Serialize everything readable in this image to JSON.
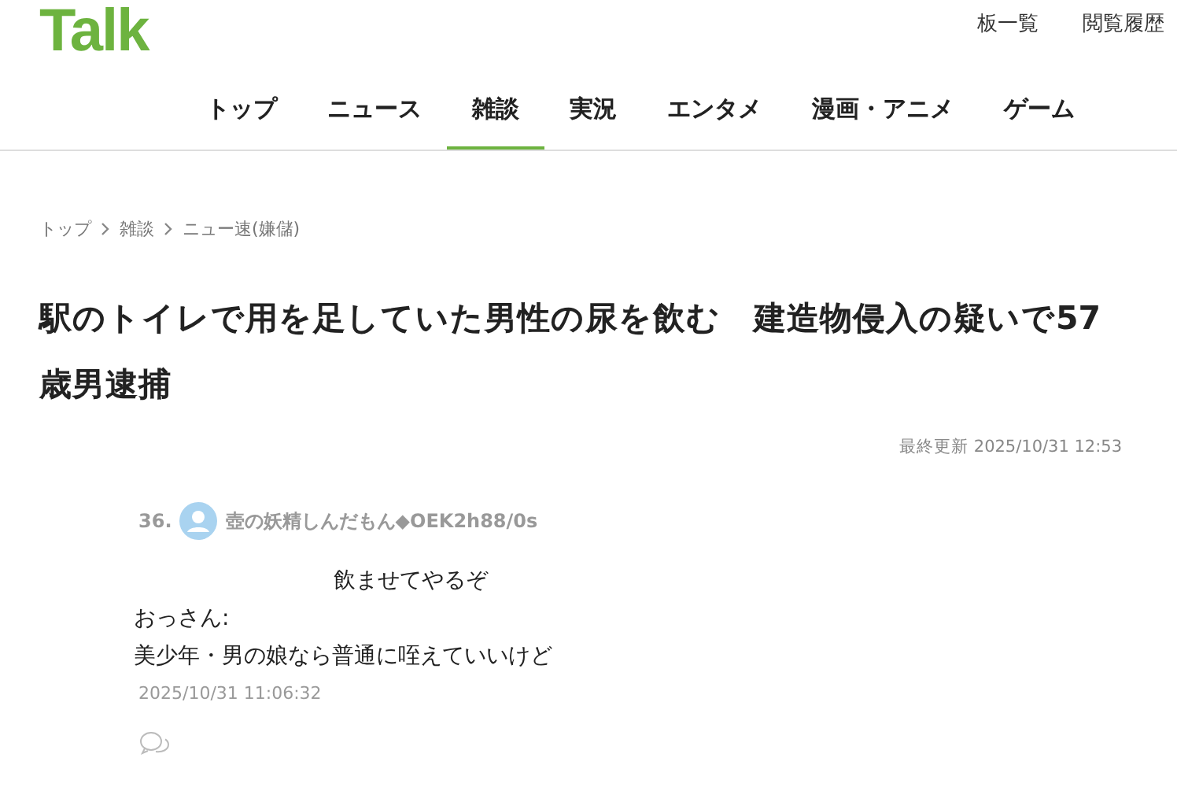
{
  "header": {
    "logo": "Talk",
    "links": [
      "板一覧",
      "閲覧履歴"
    ]
  },
  "nav": [
    {
      "label": "トップ",
      "selected": false
    },
    {
      "label": "ニュース",
      "selected": false
    },
    {
      "label": "雑談",
      "selected": true
    },
    {
      "label": "実況",
      "selected": false
    },
    {
      "label": "エンタメ",
      "selected": false
    },
    {
      "label": "漫画・アニメ",
      "selected": false
    },
    {
      "label": "ゲーム",
      "selected": false
    }
  ],
  "breadcrumb": [
    "トップ",
    "雑談",
    "ニュー速(嫌儲)"
  ],
  "article": {
    "title": "駅のトイレで用を足していた男性の尿を飲む　建造物侵入の疑いで57歳男逮捕",
    "updated": "最終更新 2025/10/31 12:53"
  },
  "comment": {
    "number": "36.",
    "author": "壺の妖精しんだもん◆OEK2h88/0s",
    "lines": [
      {
        "kind": "indented",
        "text": "飲ませてやるぞ"
      },
      {
        "kind": "plain",
        "text": "おっさん:"
      },
      {
        "kind": "plain",
        "text": "美少年・男の娘なら普通に咥えていいけど"
      }
    ],
    "date": "2025/10/31 11:06:32"
  }
}
